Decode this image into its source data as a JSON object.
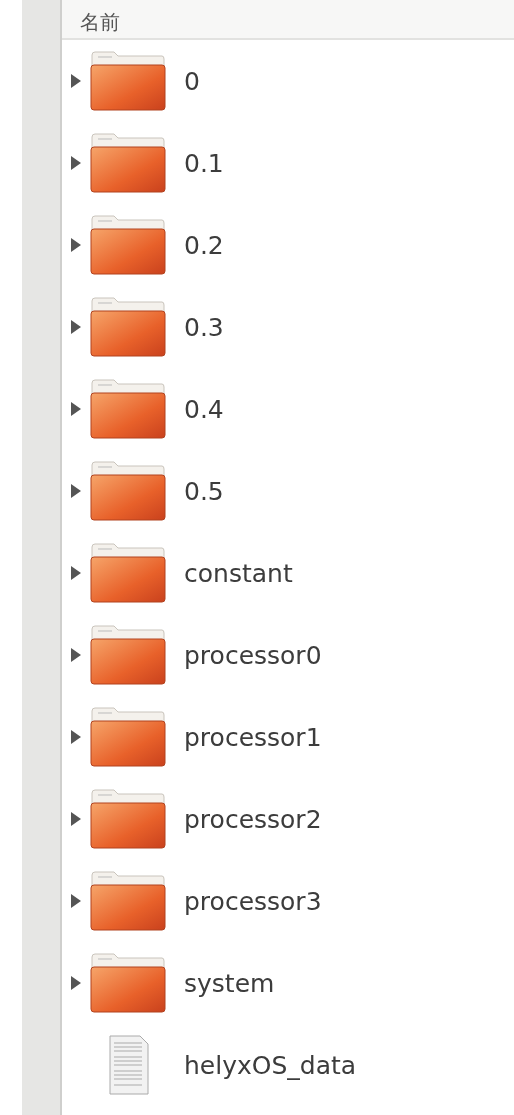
{
  "header": {
    "column_1": "名前"
  },
  "items": [
    {
      "kind": "folder",
      "name": "0",
      "expanded": false
    },
    {
      "kind": "folder",
      "name": "0.1",
      "expanded": false
    },
    {
      "kind": "folder",
      "name": "0.2",
      "expanded": false
    },
    {
      "kind": "folder",
      "name": "0.3",
      "expanded": false
    },
    {
      "kind": "folder",
      "name": "0.4",
      "expanded": false
    },
    {
      "kind": "folder",
      "name": "0.5",
      "expanded": false
    },
    {
      "kind": "folder",
      "name": "constant",
      "expanded": false
    },
    {
      "kind": "folder",
      "name": "processor0",
      "expanded": false
    },
    {
      "kind": "folder",
      "name": "processor1",
      "expanded": false
    },
    {
      "kind": "folder",
      "name": "processor2",
      "expanded": false
    },
    {
      "kind": "folder",
      "name": "processor3",
      "expanded": false
    },
    {
      "kind": "folder",
      "name": "system",
      "expanded": false
    },
    {
      "kind": "file",
      "name": "helyxOS_data"
    }
  ]
}
